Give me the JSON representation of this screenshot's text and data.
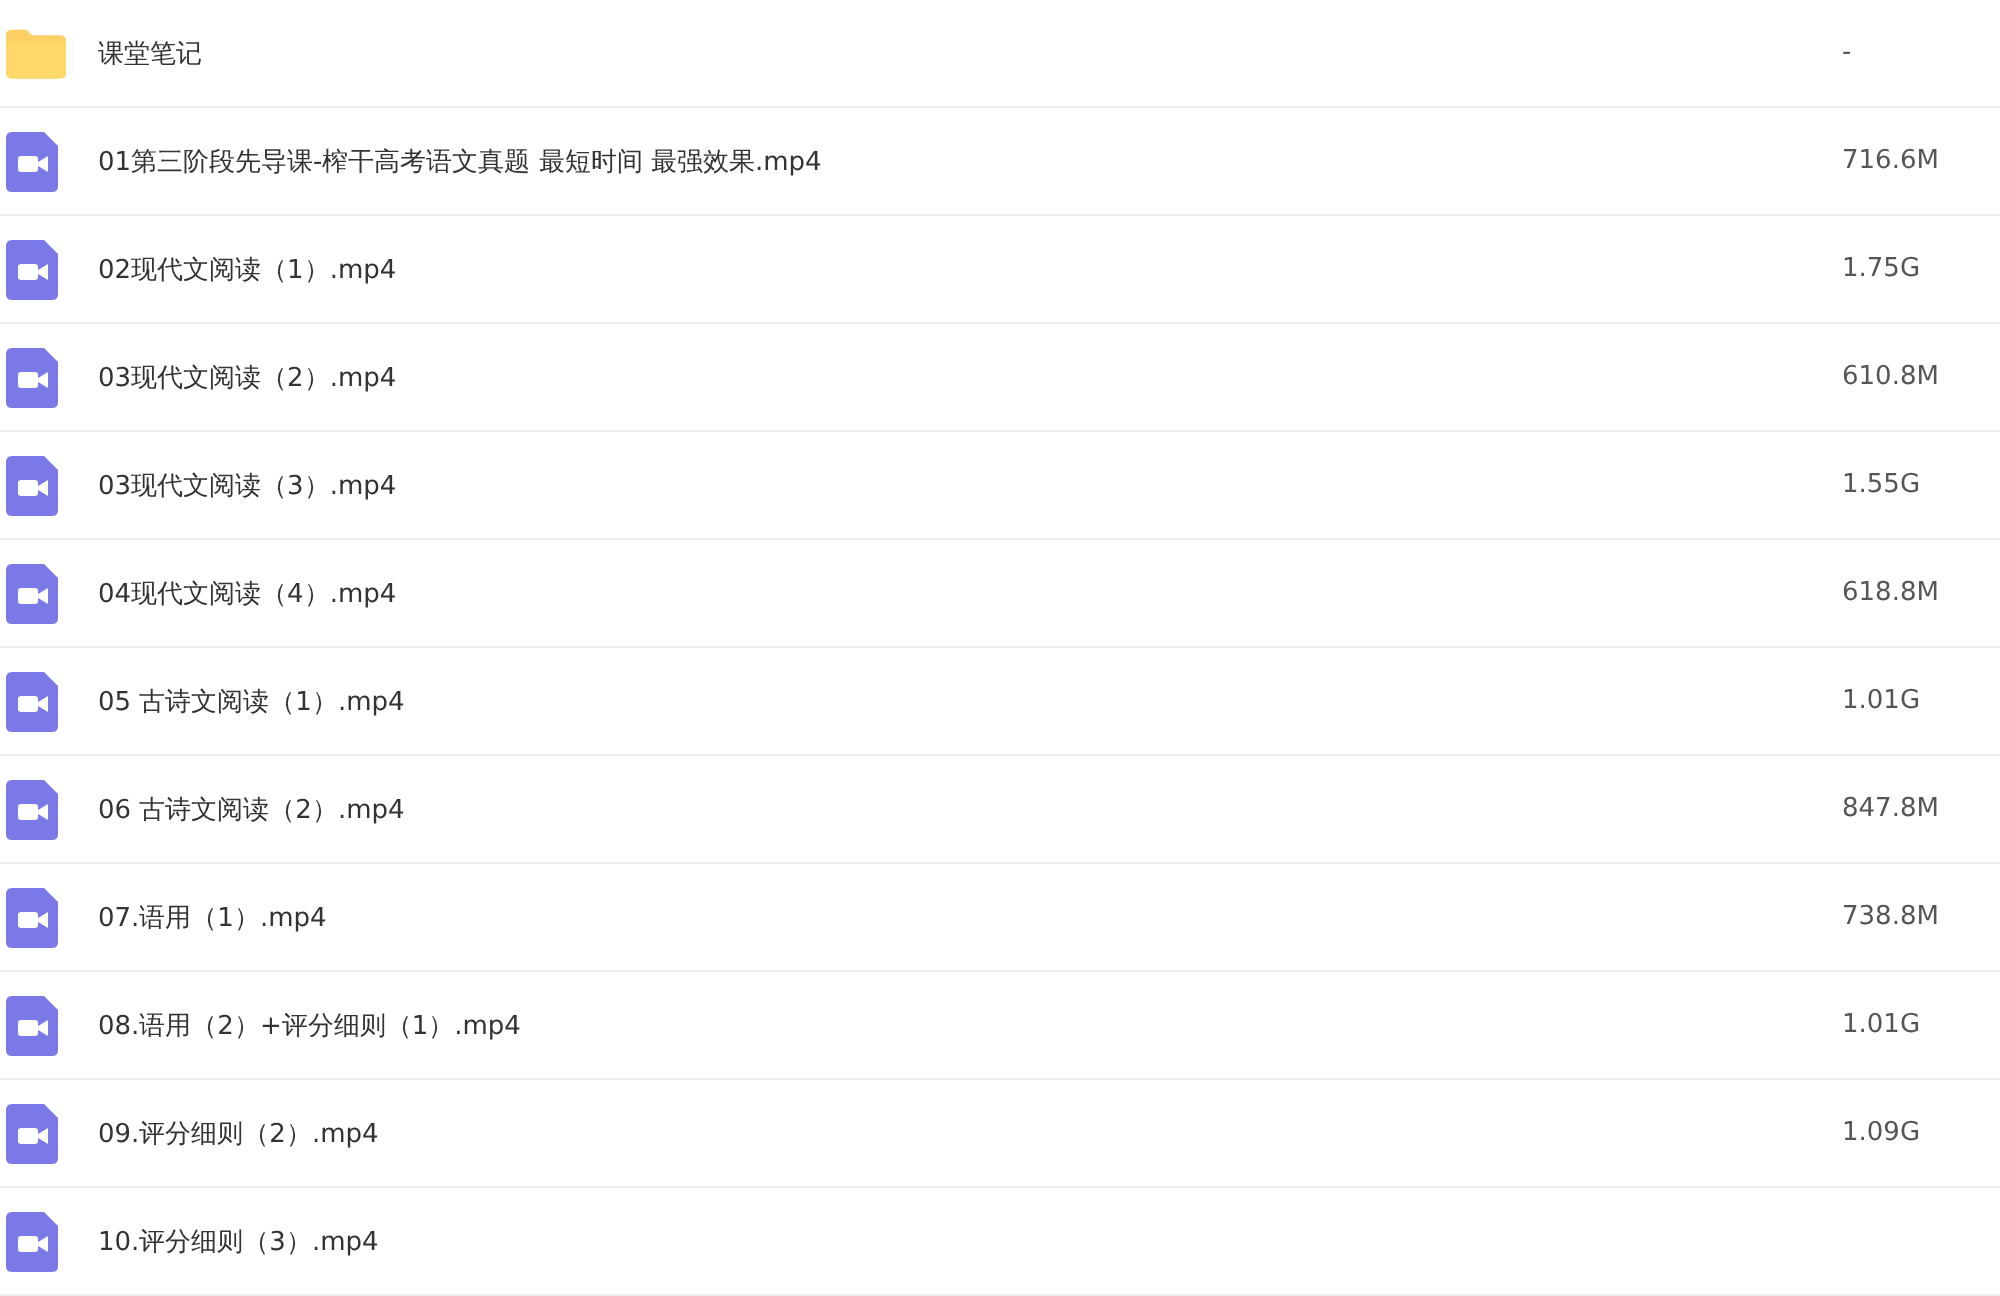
{
  "files": [
    {
      "kind": "folder",
      "name": "课堂笔记",
      "size": "-"
    },
    {
      "kind": "video",
      "name": "01第三阶段先导课-榨干高考语文真题 最短时间 最强效果.mp4",
      "size": "716.6M"
    },
    {
      "kind": "video",
      "name": "02现代文阅读（1）.mp4",
      "size": "1.75G"
    },
    {
      "kind": "video",
      "name": "03现代文阅读（2）.mp4",
      "size": "610.8M"
    },
    {
      "kind": "video",
      "name": "03现代文阅读（3）.mp4",
      "size": "1.55G"
    },
    {
      "kind": "video",
      "name": "04现代文阅读（4）.mp4",
      "size": "618.8M"
    },
    {
      "kind": "video",
      "name": "05 古诗文阅读（1）.mp4",
      "size": "1.01G"
    },
    {
      "kind": "video",
      "name": "06 古诗文阅读（2）.mp4",
      "size": "847.8M"
    },
    {
      "kind": "video",
      "name": "07.语用（1）.mp4",
      "size": "738.8M"
    },
    {
      "kind": "video",
      "name": "08.语用（2）+评分细则（1）.mp4",
      "size": "1.01G"
    },
    {
      "kind": "video",
      "name": "09.评分细则（2）.mp4",
      "size": "1.09G"
    },
    {
      "kind": "video",
      "name": "10.评分细则（3）.mp4"
    }
  ]
}
